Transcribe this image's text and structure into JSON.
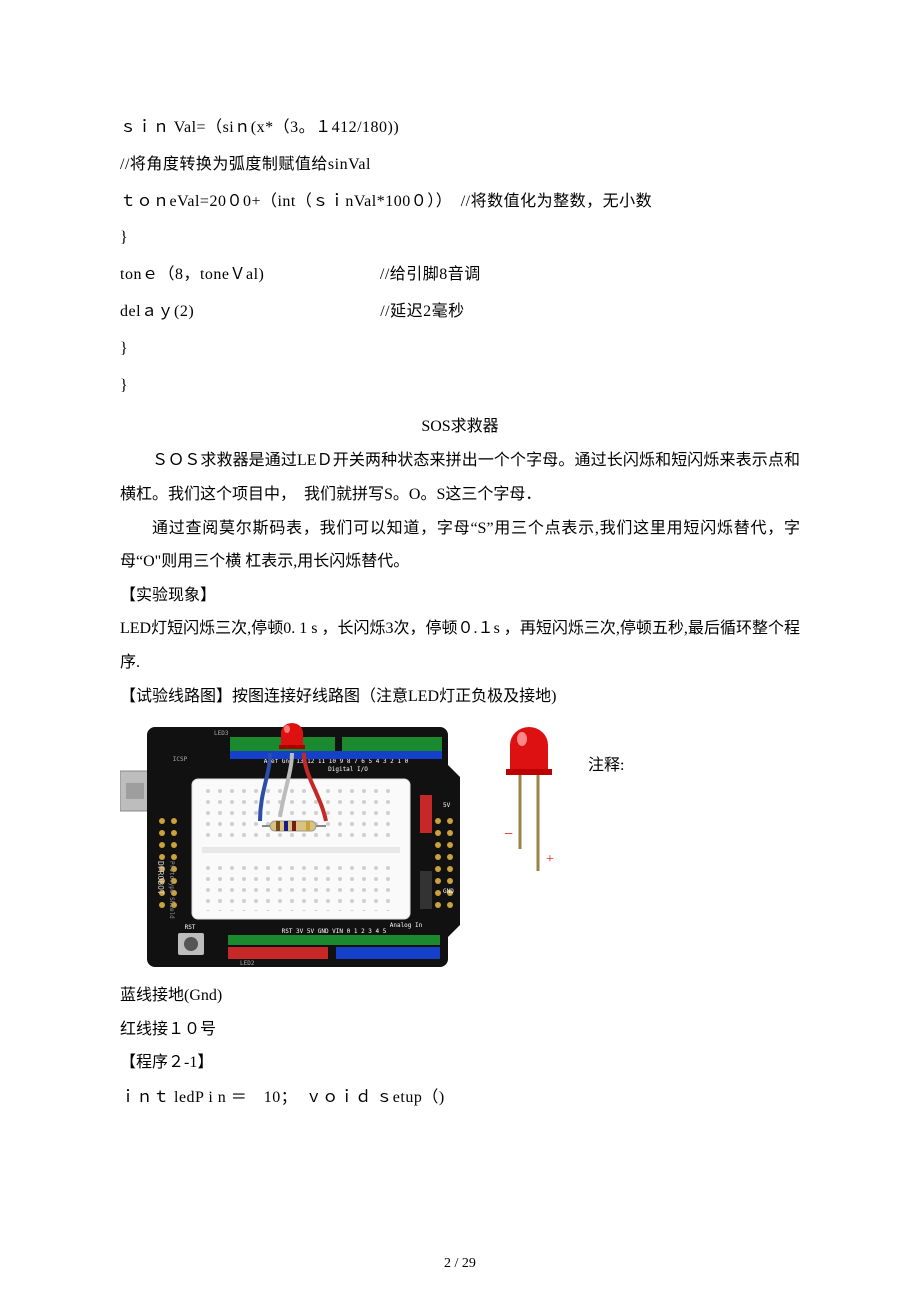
{
  "code": {
    "l1": "ｓｉｎ Val=（siｎ(x*（3。１412/180))",
    "l2": "//将角度转换为弧度制赋值给sinVal",
    "l3": "ｔｏｎeVal=20０0+（int（ｓｉnVal*100０））　//将数值化为整数，无小数",
    "l4": "}",
    "l5": "tonｅ（8，toneＶal)　　　　　　　//给引脚8音调",
    "l6": "delａｙ(2)　　　　　　　　　　　 //延迟2毫秒",
    "l7": "}",
    "l8": "}"
  },
  "title": "SOS求救器",
  "para1": "ＳＯＳ求救器是通过LEＤ开关两种状态来拼出一个个字母。通过长闪烁和短闪烁来表示点和横杠。我们这个项目中，　我们就拼写S。O。S这三个字母．",
  "para2": "通过查阅莫尔斯码表，我们可以知道，字母“S”用三个点表示,我们这里用短闪烁替代，字母“O\"则用三个横 杠表示,用长闪烁替代。",
  "exp_title": "【实验现象】",
  "exp_text": "LED灯短闪烁三次,停顿0. 1 s ，长闪烁3次，停顿０.１s ，再短闪烁三次,停顿五秒,最后循环整个程序.",
  "circuit_title": "【试验线路图】按图连接好线路图（注意LED灯正负极及接地)",
  "note": "注释:",
  "wire_blue": "蓝线接地(Gnd)",
  "wire_red": "红线接１０号",
  "prog_title": "【程序２-1】",
  "prog_code": "ｉｎｔ ledP i n ＝　10；　ｖｏｉｄ ｓetup（)",
  "led": {
    "minus": "−",
    "plus": "+"
  },
  "board": {
    "brand": "DFROBOT",
    "label2": "Prototype Shield",
    "topleft": "ICSP",
    "led3": "LED3",
    "led2": "LED2",
    "digital": "Digital I/O",
    "analog": "Analog In",
    "reset": "RST",
    "v5": "5V",
    "gnd": "GND",
    "aref": "Aref Gnd 13 12 11 10 9 8  7 6 5 4 3 2 1 0",
    "pwr_row": "RST 3V 5V GND VIN  0 1 2 3 4 5"
  },
  "pagenum": "2 / 29"
}
